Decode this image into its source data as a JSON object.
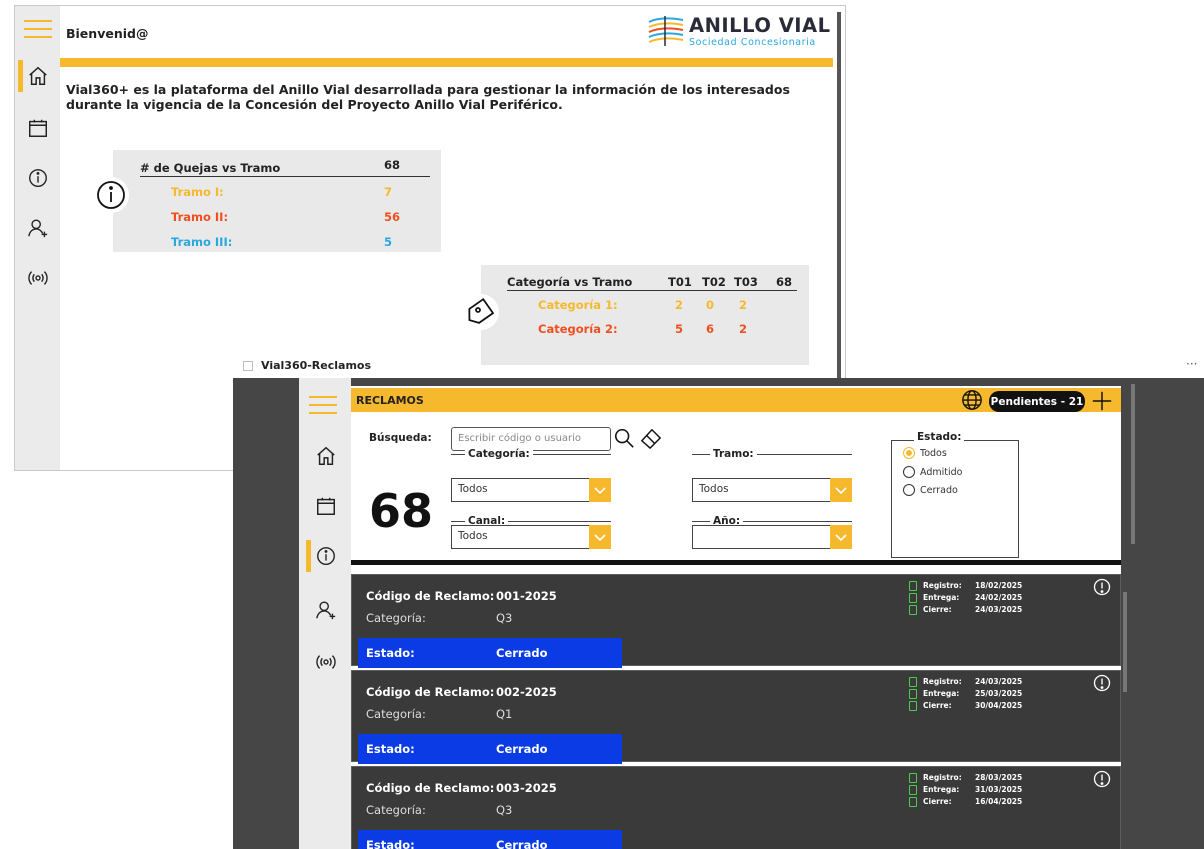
{
  "home": {
    "welcome": "Bienvenid@",
    "logo": {
      "title": "ANILLO VIAL",
      "subtitle": "Sociedad Concesionaria"
    },
    "intro": "Vial360+ es la plataforma del Anillo Vial desarrollada para gestionar la información de los interesados durante la vigencia de la Concesión del Proyecto Anillo Vial Periférico.",
    "quejas_card": {
      "title": "# de Quejas vs Tramo",
      "total": "68",
      "rows": [
        {
          "label": "Tramo I:",
          "value": "7",
          "color": "#f6b82c"
        },
        {
          "label": "Tramo II:",
          "value": "56",
          "color": "#f04e1e"
        },
        {
          "label": "Tramo III:",
          "value": "5",
          "color": "#29a8e0"
        }
      ]
    },
    "categoria_card": {
      "title": "Categoría vs Tramo",
      "headers": [
        "T01",
        "T02",
        "T03",
        "68"
      ],
      "rows": [
        {
          "label": "Categoría 1:",
          "values": [
            "2",
            "0",
            "2"
          ],
          "color": "#f6b82c"
        },
        {
          "label": "Categoría 2:",
          "values": [
            "5",
            "6",
            "2"
          ],
          "color": "#f04e1e"
        }
      ]
    }
  },
  "window_title": "Vial360-Reclamos",
  "reclamos": {
    "header": {
      "title": "RECLAMOS",
      "pendientes": "Pendientes - 21"
    },
    "filters": {
      "busqueda_label": "Búsqueda:",
      "search_placeholder": "Escribir código o usuario",
      "categoria_label": "Categoría:",
      "categoria_value": "Todos",
      "tramo_label": "Tramo:",
      "tramo_value": "Todos",
      "canal_label": "Canal:",
      "canal_value": "Todos",
      "anio_label": "Año:",
      "anio_value": "",
      "estado_label": "Estado:",
      "estado_options": [
        "Todos",
        "Admitido",
        "Cerrado"
      ],
      "estado_selected": "Todos"
    },
    "count": "68",
    "labels": {
      "codigo": "Código de Reclamo:",
      "categoria": "Categoría:",
      "estado": "Estado:",
      "registro": "Registro:",
      "entrega": "Entrega:",
      "cierre": "Cierre:"
    },
    "records": [
      {
        "codigo": "001-2025",
        "categoria": "Q3",
        "estado": "Cerrado",
        "registro": "18/02/2025",
        "entrega": "24/02/2025",
        "cierre": "24/03/2025"
      },
      {
        "codigo": "002-2025",
        "categoria": "Q1",
        "estado": "Cerrado",
        "registro": "24/03/2025",
        "entrega": "25/03/2025",
        "cierre": "30/04/2025"
      },
      {
        "codigo": "003-2025",
        "categoria": "Q3",
        "estado": "Cerrado",
        "registro": "28/03/2025",
        "entrega": "31/03/2025",
        "cierre": "16/04/2025"
      }
    ]
  },
  "colors": {
    "accent": "#f6b82c",
    "estado_bg": "#0a3be4",
    "tramo_i": "#f6b82c",
    "tramo_ii": "#f04e1e",
    "tramo_iii": "#29a8e0"
  },
  "icons": [
    "menu-icon",
    "home-icon",
    "calendar-icon",
    "info-icon",
    "add-user-icon",
    "broadcast-icon",
    "tag-icon",
    "search-icon",
    "eraser-icon",
    "globe-icon",
    "plus-icon",
    "chevron-down-icon",
    "document-icon",
    "alert-icon"
  ]
}
